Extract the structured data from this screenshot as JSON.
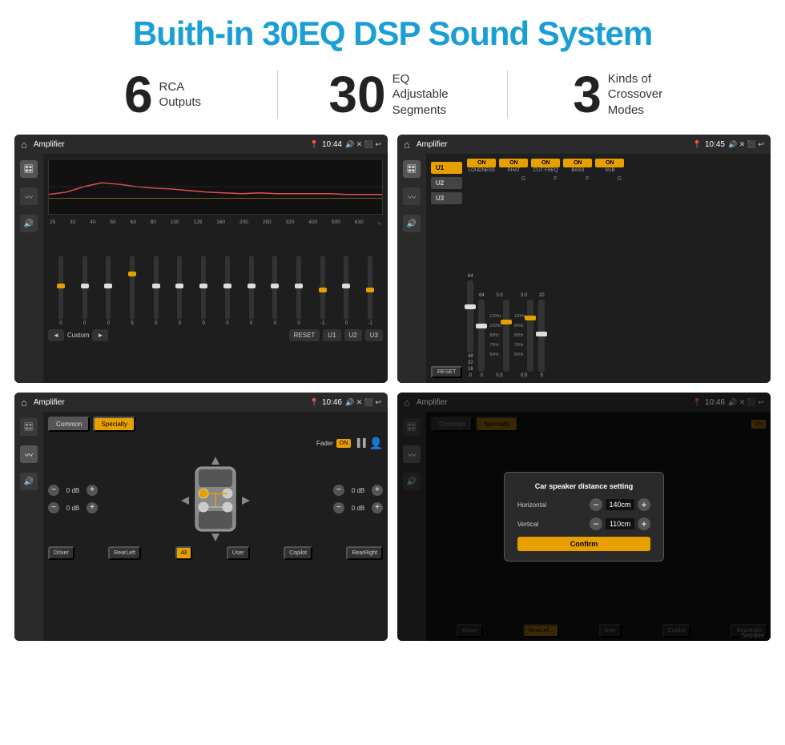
{
  "header": {
    "title": "Buith-in 30EQ DSP Sound System"
  },
  "stats": [
    {
      "number": "6",
      "label": "RCA\nOutputs"
    },
    {
      "number": "30",
      "label": "EQ Adjustable\nSegments"
    },
    {
      "number": "3",
      "label": "Kinds of\nCrossover Modes"
    }
  ],
  "screens": [
    {
      "id": "eq-screen",
      "statusBar": {
        "title": "Amplifier",
        "time": "10:44"
      },
      "type": "eq"
    },
    {
      "id": "crossover-screen",
      "statusBar": {
        "title": "Amplifier",
        "time": "10:45"
      },
      "type": "crossover"
    },
    {
      "id": "speaker-screen",
      "statusBar": {
        "title": "Amplifier",
        "time": "10:46"
      },
      "type": "speaker"
    },
    {
      "id": "speaker-dialog-screen",
      "statusBar": {
        "title": "Amplifier",
        "time": "10:46"
      },
      "type": "speaker-dialog",
      "dialog": {
        "title": "Car speaker distance setting",
        "horizontal": {
          "label": "Horizontal",
          "value": "140cm"
        },
        "vertical": {
          "label": "Vertical",
          "value": "110cm"
        },
        "confirmLabel": "Confirm"
      }
    }
  ],
  "eq": {
    "frequencies": [
      "25",
      "32",
      "40",
      "50",
      "63",
      "80",
      "100",
      "125",
      "160",
      "200",
      "250",
      "320",
      "400",
      "500",
      "630"
    ],
    "values": [
      "0",
      "0",
      "0",
      "5",
      "0",
      "0",
      "0",
      "0",
      "0",
      "0",
      "0",
      "-1",
      "0",
      "-1"
    ],
    "buttons": {
      "prev": "◄",
      "label": "Custom",
      "next": "►",
      "reset": "RESET",
      "u1": "U1",
      "u2": "U2",
      "u3": "U3"
    }
  },
  "crossover": {
    "userTabs": [
      "U1",
      "U2",
      "U3"
    ],
    "channels": [
      {
        "label": "LOUDNESS",
        "on": true
      },
      {
        "label": "PHAT",
        "on": true
      },
      {
        "label": "CUT FREQ",
        "on": true
      },
      {
        "label": "BASS",
        "on": true
      },
      {
        "label": "SUB",
        "on": true
      }
    ],
    "resetLabel": "RESET"
  },
  "speaker": {
    "tabs": [
      "Common",
      "Specialty"
    ],
    "activeTab": "Specialty",
    "faderLabel": "Fader",
    "faderOn": "ON",
    "dbValues": [
      "0 dB",
      "0 dB",
      "0 dB",
      "0 dB"
    ],
    "buttons": {
      "driver": "Driver",
      "rearLeft": "RearLeft",
      "all": "All",
      "user": "User",
      "copilot": "Copilot",
      "rearRight": "RearRight"
    }
  },
  "dialog": {
    "title": "Car speaker distance setting",
    "horizontalLabel": "Horizontal",
    "horizontalValue": "140cm",
    "verticalLabel": "Vertical",
    "verticalValue": "110cm",
    "confirmLabel": "Confirm"
  },
  "watermark": "Seicane"
}
